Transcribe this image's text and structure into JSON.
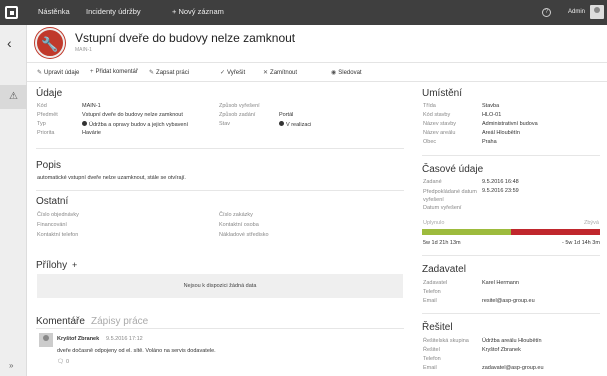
{
  "topbar": {
    "nav_dashboard": "Nástěnka",
    "nav_incidents": "Incidenty údržby",
    "nav_new": "+ Nový záznam",
    "help": "?",
    "user": "Admin"
  },
  "header": {
    "title": "Vstupní dveře do budovy nelze zamknout",
    "code": "MAIN-1",
    "icon": "wrench-icon"
  },
  "actions": {
    "edit": "Upravit údaje",
    "add_comment": "Přidat komentář",
    "log_work": "Zapsat práci",
    "resolve": "Vyřešit",
    "reject": "Zamítnout",
    "follow": "Sledovat"
  },
  "details": {
    "title": "Údaje",
    "kod_label": "Kód",
    "kod_value": "MAIN-1",
    "predmet_label": "Předmět",
    "predmet_value": "Vstupní dveře do budovy nelze zamknout",
    "typ_label": "Typ",
    "typ_value": "Údržba a opravy budov a jejich vybavení",
    "priorita_label": "Priorita",
    "priorita_value": "Havárie",
    "zpusob_vyreseni_label": "Způsob vyřešení",
    "zpusob_vyreseni_value": "",
    "zpusob_zadani_label": "Způsob zadání",
    "zpusob_zadani_value": "Portál",
    "stav_label": "Stav",
    "stav_value": "V realizaci"
  },
  "description": {
    "title": "Popis",
    "text": "automatické vstupní dveře nelze uzamknout, stále se otvírají."
  },
  "other": {
    "title": "Ostatní",
    "objednavky": "Číslo objednávky",
    "financovani": "Financování",
    "kontaktni_telefon": "Kontaktní telefon",
    "zakazky": "Číslo zakázky",
    "kontaktni_osoba": "Kontaktní osoba",
    "nakladove": "Nákladové středisko"
  },
  "attachments": {
    "title": "Přílohy",
    "add": "+",
    "empty": "Nejsou k dispozici žádná data"
  },
  "comments": {
    "tab_comments": "Komentáře",
    "tab_work": "Zápisy práce",
    "author": "Kryštof Zbranek",
    "time": "9.5.2016 17:12",
    "text": "dveře dočasně odpojeny od el. sítě. Voláno na servis dodavatele.",
    "likes": "0"
  },
  "location": {
    "title": "Umístění",
    "trida_label": "Třída",
    "trida_value": "Stavba",
    "kod_stavby_label": "Kód stavby",
    "kod_stavby_value": "HLO-01",
    "nazev_stavby_label": "Název stavby",
    "nazev_stavby_value": "Administrativní budova",
    "nazev_arealu_label": "Název areálu",
    "nazev_arealu_value": "Areál Hloubětín",
    "obec_label": "Obec",
    "obec_value": "Praha"
  },
  "timing": {
    "title": "Časové údaje",
    "zadano_label": "Zadané",
    "zadano_value": "9.5.2016 16:48",
    "predpokladane_label": "Předpokládané datum vyřešení",
    "predpokladane_value": "9.5.2016 23:59",
    "datum_label": "Datum vyřešení",
    "datum_value": "",
    "uplynulo_label": "Uplynulo",
    "zbyva_label": "Zbývá",
    "uplynulo_value": "5w 1d 21h 13m",
    "zbyva_value": "- 5w 1d 14h 3m",
    "progress_elapsed_fraction": 0.5,
    "color_elapsed": "#9dbb3d",
    "color_overdue": "#c0272d"
  },
  "requester": {
    "title": "Zadavatel",
    "zadavatel_label": "Zadavatel",
    "zadavatel_value": "Karel Hermann",
    "telefon_label": "Telefon",
    "telefon_value": "",
    "email_label": "Email",
    "email_value": "resitel@asp-group.eu"
  },
  "solver": {
    "title": "Řešitel",
    "skupina_label": "Řešitelská skupina",
    "skupina_value": "Údržba areálu Hloubětín",
    "resitel_label": "Řešitel",
    "resitel_value": "Kryštof Zbranek",
    "telefon_label": "Telefon",
    "telefon_value": "",
    "email_label": "Email",
    "email_value": "zadavatel@asp-group.eu"
  }
}
